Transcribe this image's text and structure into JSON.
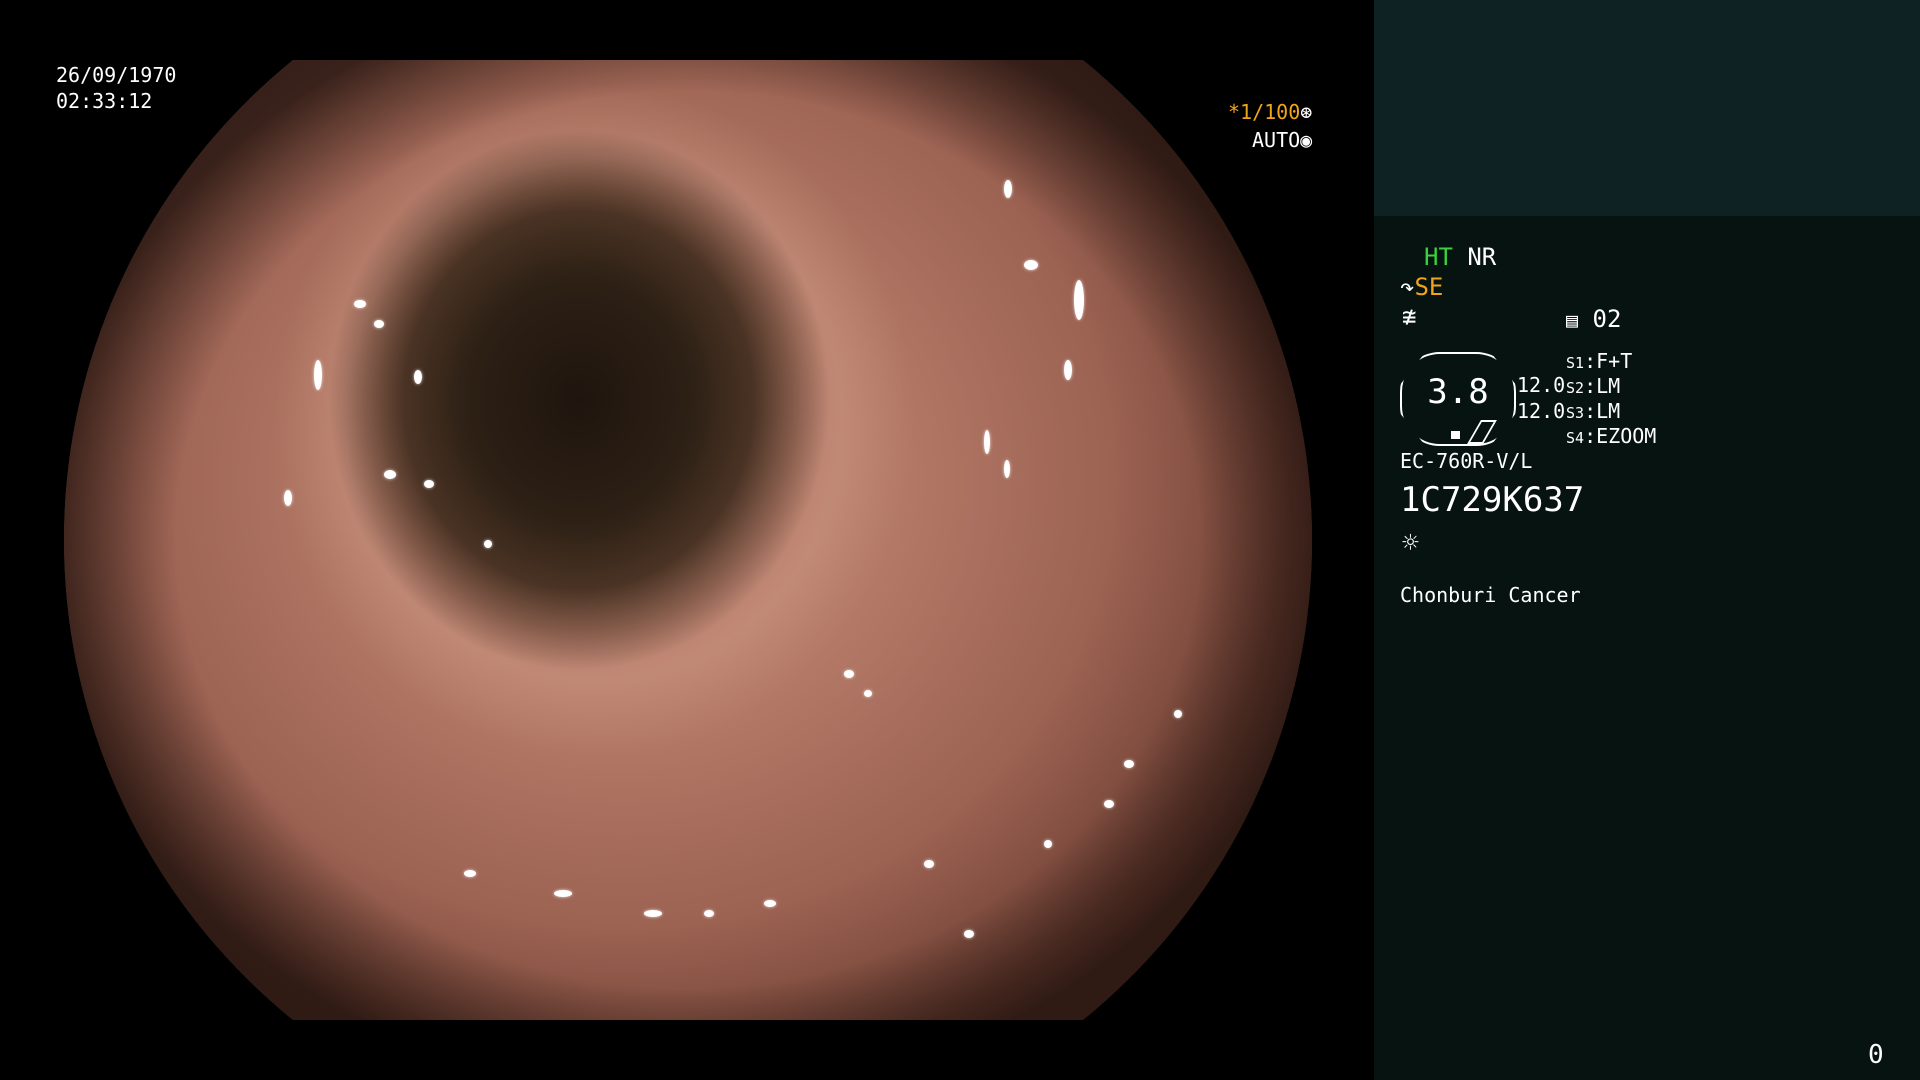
{
  "overlay": {
    "date": "26/09/1970",
    "time": "02:33:12",
    "shutter": "*1/100",
    "shutter_icon": "shutter-icon",
    "iris_mode": "AUTO",
    "iris_icon": "iris-icon"
  },
  "panel": {
    "ht": "HT",
    "nr": "NR",
    "se": "SE",
    "se_icon": "enhance-icon",
    "edge_icon": "edge-icon",
    "memory_icon": "memory-icon",
    "memory": "02",
    "gauge_value": "3.8",
    "values": [
      "12.0",
      "12.0"
    ],
    "switches": [
      {
        "label": "S1",
        "value": "F+T"
      },
      {
        "label": "S2",
        "value": "LM"
      },
      {
        "label": "S3",
        "value": "LM"
      },
      {
        "label": "S4",
        "value": "EZOOM"
      }
    ],
    "scope_model": "EC-760R-V/L",
    "serial": "1C729K637",
    "light_icon": "light-icon",
    "institution": "Chonburi Cancer",
    "counter": "0"
  },
  "colors": {
    "ht": "#39d23a",
    "se": "#f0a41e",
    "panel_top": "#0e2223",
    "panel": "#061311"
  }
}
